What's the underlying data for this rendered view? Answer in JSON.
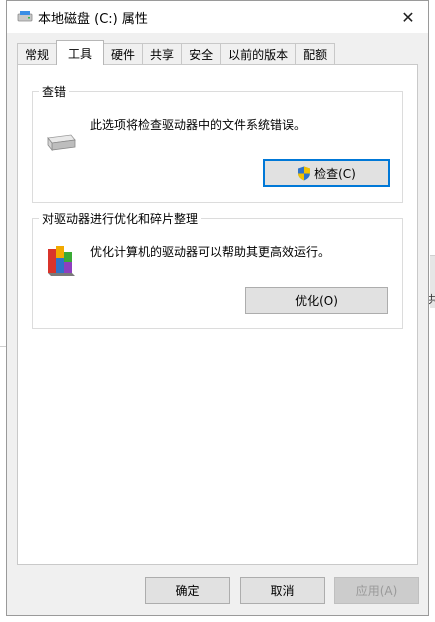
{
  "window": {
    "title": "本地磁盘 (C:) 属性",
    "close_symbol": "✕"
  },
  "tabs": [
    {
      "label": "常规",
      "active": false
    },
    {
      "label": "工具",
      "active": true
    },
    {
      "label": "硬件",
      "active": false
    },
    {
      "label": "共享",
      "active": false
    },
    {
      "label": "安全",
      "active": false
    },
    {
      "label": "以前的版本",
      "active": false
    },
    {
      "label": "配额",
      "active": false
    }
  ],
  "error_check": {
    "group_title": "查错",
    "description": "此选项将检查驱动器中的文件系统错误。",
    "button_label": "检查(C)",
    "icon": "drive-icon"
  },
  "optimize": {
    "group_title": "对驱动器进行优化和碎片整理",
    "description": "优化计算机的驱动器可以帮助其更高效运行。",
    "button_label": "优化(O)",
    "icon": "defrag-icon"
  },
  "footer": {
    "ok_label": "确定",
    "cancel_label": "取消",
    "apply_label": "应用(A)",
    "apply_enabled": false
  },
  "background": {
    "glyph": "共"
  },
  "colors": {
    "accent": "#0078d7",
    "dialog_bg": "#f0f0f0",
    "button_bg": "#e1e1e1",
    "disabled_text": "#9a9a9a"
  }
}
